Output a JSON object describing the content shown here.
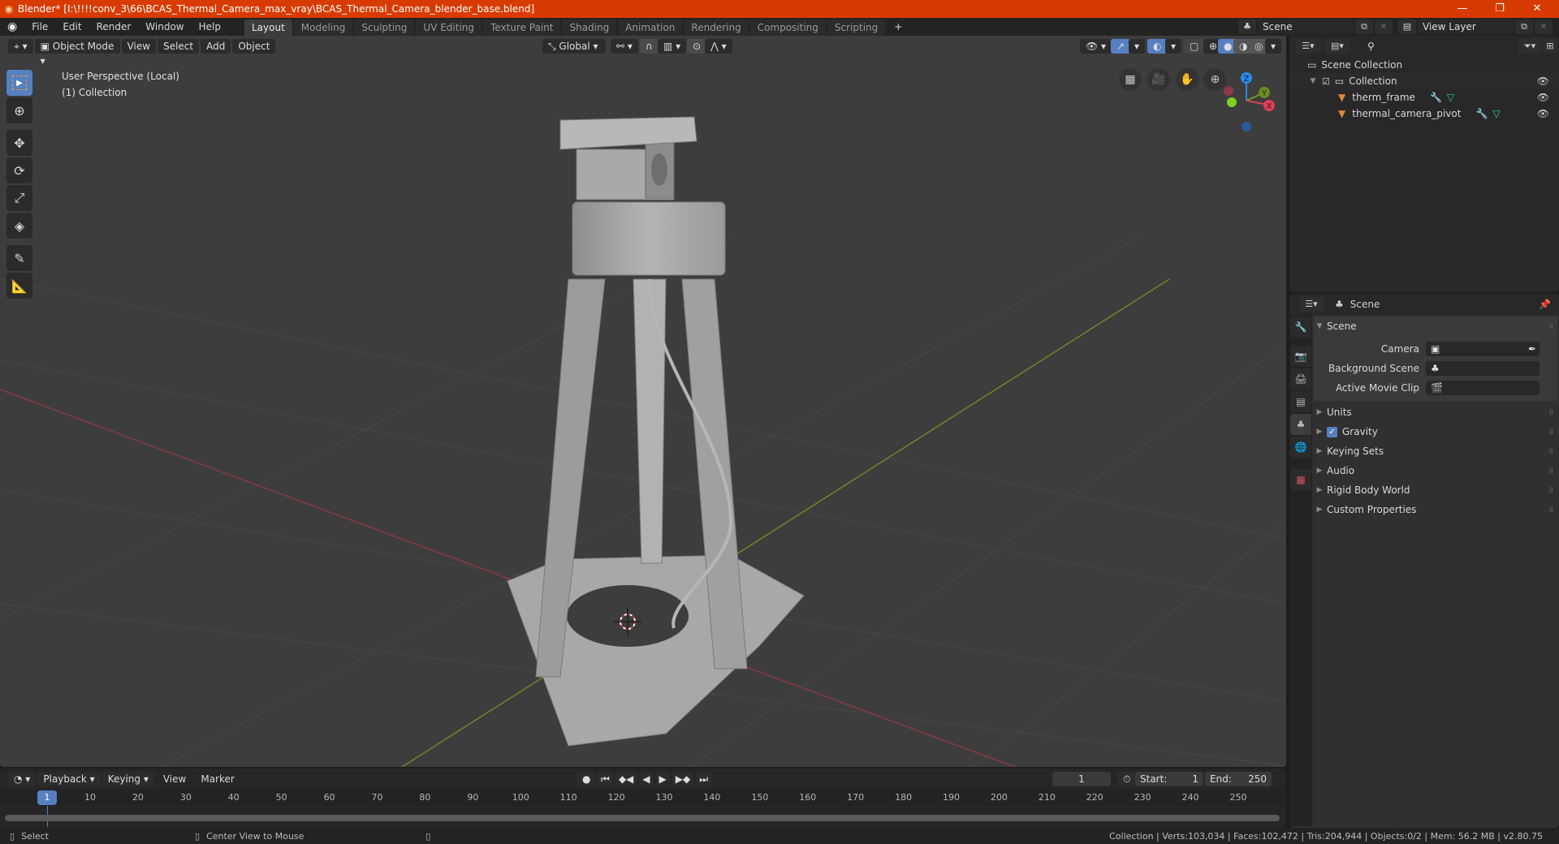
{
  "titlebar": {
    "title": "Blender* [I:\\!!!!conv_3\\66\\BCAS_Thermal_Camera_max_vray\\BCAS_Thermal_Camera_blender_base.blend]",
    "minimize": "—",
    "maximize": "❐",
    "close": "✕"
  },
  "menu": [
    "File",
    "Edit",
    "Render",
    "Window",
    "Help"
  ],
  "workspaces": [
    "Layout",
    "Modeling",
    "Sculpting",
    "UV Editing",
    "Texture Paint",
    "Shading",
    "Animation",
    "Rendering",
    "Compositing",
    "Scripting"
  ],
  "active_workspace": "Layout",
  "add_workspace": "+",
  "scene_selector": {
    "value": "Scene"
  },
  "viewlayer_selector": {
    "value": "View Layer"
  },
  "viewport": {
    "mode": "Object Mode",
    "menus": [
      "View",
      "Select",
      "Add",
      "Object"
    ],
    "orientation": "Global",
    "overlay_text_line1": "User Perspective (Local)",
    "overlay_text_line2": "(1) Collection",
    "gizmo": {
      "z": "Z",
      "y": "Y",
      "x": "X"
    },
    "colors": {
      "x_axis": "#c0404f",
      "y_axis": "#7a9a22",
      "z_axis": "#2c8ae8",
      "active_tool": "#5680c2"
    }
  },
  "outliner": {
    "root": "Scene Collection",
    "collection": "Collection",
    "items": [
      {
        "name": "therm_frame"
      },
      {
        "name": "thermal_camera_pivot"
      }
    ]
  },
  "properties": {
    "context": "Scene",
    "section": "Scene",
    "fields": [
      {
        "label": "Camera",
        "value": ""
      },
      {
        "label": "Background Scene",
        "value": ""
      },
      {
        "label": "Active Movie Clip",
        "value": ""
      }
    ],
    "panels": [
      {
        "label": "Units",
        "checkbox": false
      },
      {
        "label": "Gravity",
        "checkbox": true
      },
      {
        "label": "Keying Sets",
        "checkbox": false
      },
      {
        "label": "Audio",
        "checkbox": false
      },
      {
        "label": "Rigid Body World",
        "checkbox": false
      },
      {
        "label": "Custom Properties",
        "checkbox": false
      }
    ]
  },
  "timeline": {
    "menus": [
      "Playback",
      "Keying",
      "View",
      "Marker"
    ],
    "current_frame": "1",
    "start_label": "Start:",
    "start": "1",
    "end_label": "End:",
    "end": "250",
    "ruler": [
      "10",
      "20",
      "30",
      "40",
      "50",
      "60",
      "70",
      "80",
      "90",
      "100",
      "110",
      "120",
      "130",
      "140",
      "150",
      "160",
      "170",
      "180",
      "190",
      "200",
      "210",
      "220",
      "230",
      "240",
      "250"
    ],
    "playhead": "1"
  },
  "statusbar": {
    "left_action": "Select",
    "middle_action": "Center View to Mouse",
    "stats": "Collection | Verts:103,034 | Faces:102,472 | Tris:204,944 | Objects:0/2 | Mem: 56.2 MB | v2.80.75"
  }
}
